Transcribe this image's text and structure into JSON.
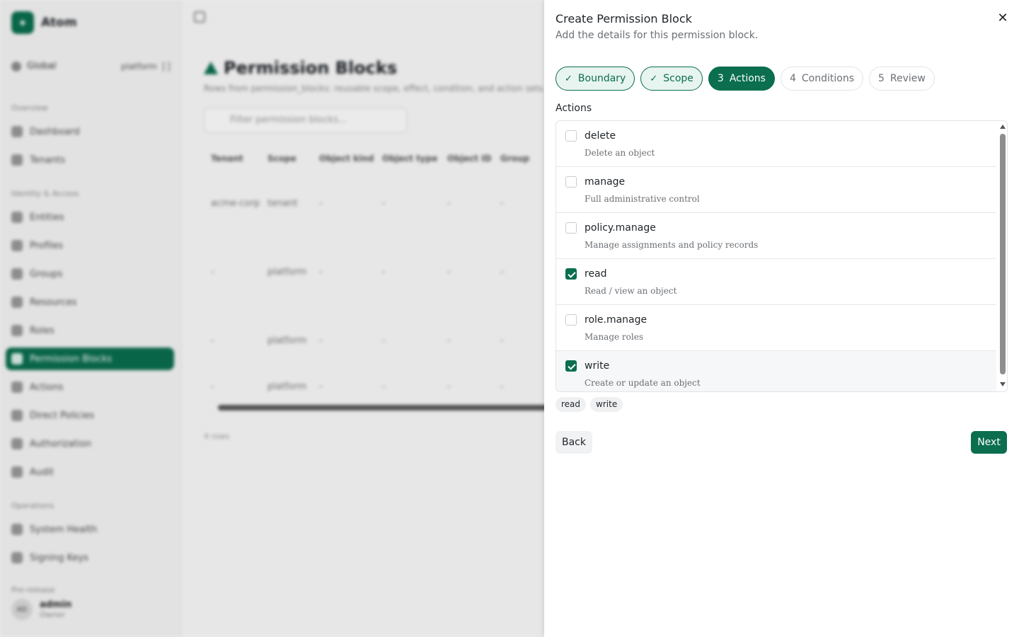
{
  "app": {
    "brand_name": "Atom",
    "context_label": "Global",
    "context_value": "platform",
    "page_title": "Permission Blocks",
    "page_description": "Rows from permission_blocks: reusable scope, effect, condition, and action sets.",
    "filter_placeholder": "Filter permission blocks...",
    "row_count": "4 rows",
    "sidebar": {
      "sections": [
        {
          "label": "Overview",
          "items": [
            "Dashboard",
            "Tenants"
          ]
        },
        {
          "label": "Identity & Access",
          "items": [
            "Entities",
            "Profiles",
            "Groups",
            "Resources",
            "Roles",
            "Permission Blocks",
            "Actions",
            "Direct Policies",
            "Authorization",
            "Audit"
          ]
        },
        {
          "label": "Operations",
          "items": [
            "System Health",
            "Signing Keys"
          ]
        }
      ],
      "footer_label": "Pre-release",
      "user": {
        "initials": "AD",
        "name": "admin",
        "role": "Owner"
      }
    },
    "table": {
      "columns": [
        "Tenant",
        "Scope",
        "Object kind",
        "Object type",
        "Object ID",
        "Group"
      ],
      "rows": [
        [
          "acme-corp",
          "tenant",
          "-",
          "-",
          "-",
          "-"
        ],
        [
          "-",
          "platform",
          "-",
          "-",
          "-",
          "-"
        ],
        [
          "-",
          "platform",
          "-",
          "-",
          "-",
          "-"
        ],
        [
          "-",
          "platform",
          "-",
          "-",
          "-",
          "-"
        ]
      ]
    }
  },
  "drawer": {
    "title": "Create Permission Block",
    "subtitle": "Add the details for this permission block.",
    "steps": [
      {
        "label": "Boundary",
        "state": "done"
      },
      {
        "num": "3",
        "label": "Actions",
        "state": "current"
      },
      {
        "label": "Scope",
        "state": "done"
      },
      {
        "num": "4",
        "label": "Conditions",
        "state": "pending"
      },
      {
        "num": "5",
        "label": "Review",
        "state": "pending"
      }
    ],
    "section_label": "Actions",
    "actions": [
      {
        "name": "delete",
        "description": "Delete an object",
        "checked": false
      },
      {
        "name": "manage",
        "description": "Full administrative control",
        "checked": false
      },
      {
        "name": "policy.manage",
        "description": "Manage assignments and policy records",
        "checked": false
      },
      {
        "name": "read",
        "description": "Read / view an object",
        "checked": true
      },
      {
        "name": "role.manage",
        "description": "Manage roles",
        "checked": false
      },
      {
        "name": "write",
        "description": "Create or update an object",
        "checked": true
      }
    ],
    "selected_chips": [
      "read",
      "write"
    ],
    "back_label": "Back",
    "next_label": "Next",
    "accent_color": "#0a6e4f"
  }
}
